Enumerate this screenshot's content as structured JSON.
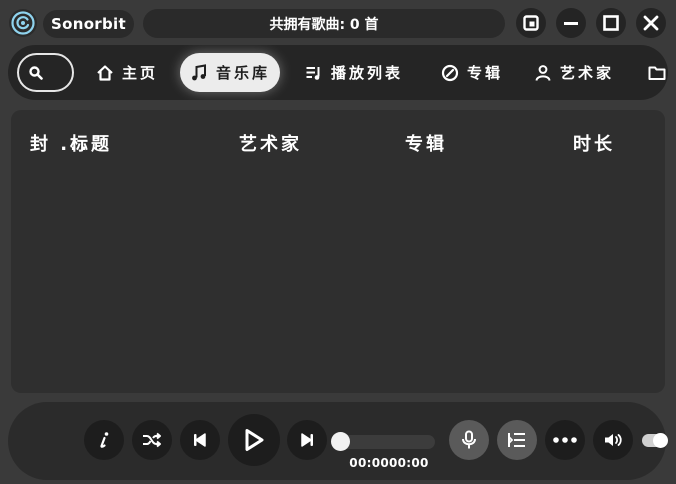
{
  "window": {
    "app_name": "Sonorbit",
    "song_count_text": "共拥有歌曲: 0 首",
    "controls": [
      "restore-icon",
      "minimize-icon",
      "maximize-icon",
      "close-icon"
    ]
  },
  "nav": {
    "search_icon": "search-icon",
    "items": [
      {
        "label": "主页",
        "icon": "home-icon",
        "active": false
      },
      {
        "label": "音乐库",
        "icon": "music-note-icon",
        "active": true
      },
      {
        "label": "播放列表",
        "icon": "playlist-icon",
        "active": false
      },
      {
        "label": "专辑",
        "icon": "album-icon",
        "active": false
      },
      {
        "label": "艺术家",
        "icon": "person-icon",
        "active": false
      },
      {
        "label": "",
        "icon": "folder-icon",
        "active": false
      }
    ]
  },
  "library": {
    "columns": [
      "封 ...",
      "标题",
      "艺术家",
      "专辑",
      "时长"
    ],
    "rows": []
  },
  "player": {
    "time_text": "00:0000:00",
    "progress": 0,
    "volume_enabled": true,
    "buttons": [
      "info-icon",
      "shuffle-icon",
      "previous-icon",
      "play-icon",
      "next-icon",
      "microphone-icon",
      "queue-list-icon",
      "more-icon",
      "volume-icon"
    ]
  },
  "colors": {
    "background": "#3a3a3a",
    "panel": "#2f2f2f",
    "bar": "#252525",
    "active_tab": "#ececec"
  }
}
